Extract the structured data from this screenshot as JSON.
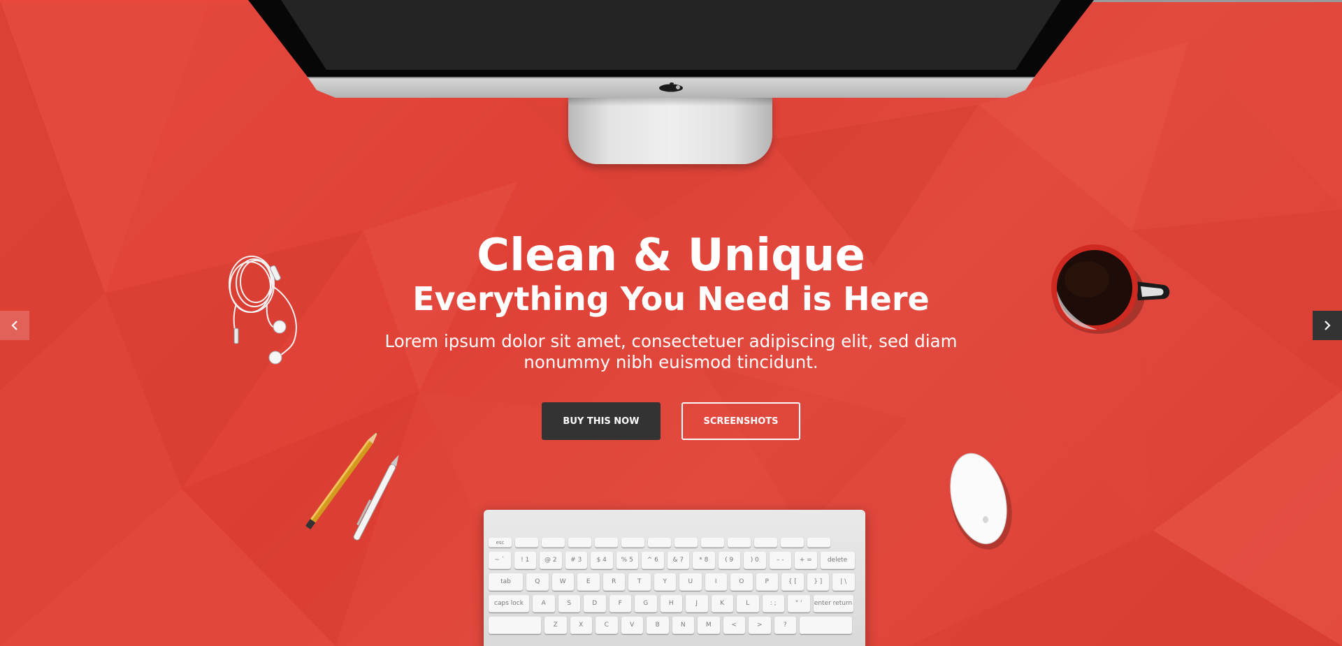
{
  "slider": {
    "progress": 0.49,
    "title": "Clean & Unique",
    "subtitle": "Everything You Need is Here",
    "lead": "Lorem ipsum dolor sit amet, consectetuer adipiscing elit, sed diam nonummy nibh euismod tincidunt.",
    "buy_label": "BUY THIS NOW",
    "screenshots_label": "SCREENSHOTS"
  },
  "colors": {
    "background": "#e0473c",
    "button_dark": "#333333",
    "text": "#ffffff"
  },
  "icons": {
    "prev": "chevron-left-icon",
    "next": "chevron-right-icon",
    "brand": "apple-logo-icon"
  },
  "keyboard": {
    "row_fn": [
      "esc",
      "",
      "",
      "",
      "",
      "",
      "",
      "",
      "",
      "",
      "",
      "",
      ""
    ],
    "row_num": [
      "~ `",
      "! 1",
      "@ 2",
      "# 3",
      "$ 4",
      "% 5",
      "^ 6",
      "& 7",
      "* 8",
      "( 9",
      ") 0",
      "– -",
      "+ =",
      "delete"
    ],
    "row_q": [
      "tab",
      "Q",
      "W",
      "E",
      "R",
      "T",
      "Y",
      "U",
      "I",
      "O",
      "P",
      "{ [",
      "} ]",
      "| \\"
    ],
    "row_a": [
      "caps lock",
      "A",
      "S",
      "D",
      "F",
      "G",
      "H",
      "J",
      "K",
      "L",
      ": ;",
      "\" '",
      "enter return"
    ],
    "row_z": [
      "",
      "Z",
      "X",
      "C",
      "V",
      "B",
      "N",
      "M",
      "<",
      ">",
      "?",
      ""
    ]
  }
}
